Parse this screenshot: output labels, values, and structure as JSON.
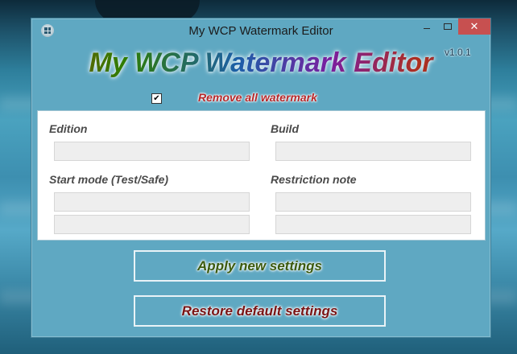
{
  "window": {
    "title": "My WCP Watermark Editor",
    "close_glyph": "✕"
  },
  "header": {
    "banner": "My WCP Watermark Editor",
    "version": "v1.0.1"
  },
  "options": {
    "remove_all_checked": true,
    "checkmark": "✔",
    "remove_all_label": "Remove all watermark"
  },
  "fields": {
    "edition_label": "Edition",
    "edition_value": "",
    "build_label": "Build",
    "build_value": "",
    "start_mode_label": "Start mode (Test/Safe)",
    "start_mode_value_1": "",
    "start_mode_value_2": "",
    "restriction_note_label": "Restriction note",
    "restriction_note_value_1": "",
    "restriction_note_value_2": ""
  },
  "actions": {
    "apply_label": "Apply new settings",
    "restore_label": "Restore default settings"
  },
  "colors": {
    "window_bg": "#5fa8c2",
    "close_button": "#c75050",
    "remove_label": "#b8282a",
    "apply_text": "#3b5a0e",
    "restore_text": "#7a1414"
  },
  "icons": {
    "app_icon": "windows-logo-icon",
    "minimize": "minimize-icon",
    "maximize": "maximize-icon",
    "close": "close-icon"
  }
}
